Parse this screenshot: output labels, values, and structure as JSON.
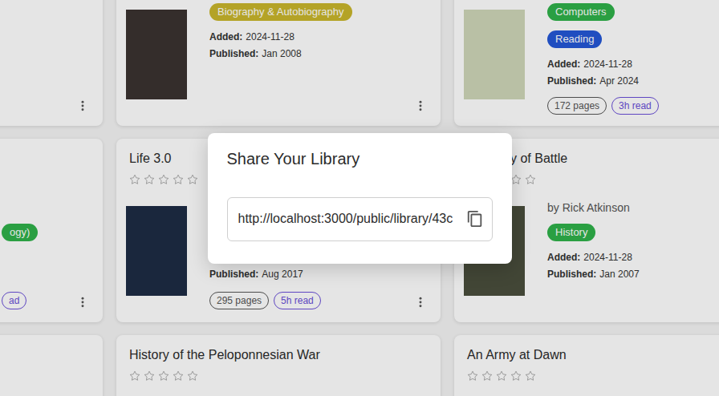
{
  "library": {
    "rows": [
      {
        "cards": [
          {
            "cover": false,
            "tags": [],
            "details": [],
            "chips": []
          },
          {
            "cover": true,
            "tags": [
              {
                "label": "Biography & Autobiography",
                "color": "#c9b62c"
              }
            ],
            "details": [
              {
                "label": "Added:",
                "value": "2024-11-28"
              },
              {
                "label": "Published:",
                "value": "Jan 2008"
              }
            ],
            "chips": []
          },
          {
            "cover": true,
            "tags": [
              {
                "label": "Computers",
                "color": "#2fb24a"
              },
              {
                "label": "Reading",
                "color": "#2457d6"
              }
            ],
            "details": [
              {
                "label": "Added:",
                "value": "2024-11-28"
              },
              {
                "label": "Published:",
                "value": "Apr 2024"
              }
            ],
            "chips": [
              {
                "label": "172 pages",
                "color": "#555555"
              },
              {
                "label": "3h read",
                "color": "#6a4fd8"
              }
            ]
          }
        ]
      },
      {
        "cards": [
          {
            "cover": false,
            "tags": [
              {
                "label": "ogy)",
                "color": "#2fb24a"
              }
            ],
            "details": [],
            "chips": [
              {
                "label": "ad",
                "color": "#6a4fd8"
              }
            ]
          },
          {
            "title": "Life 3.0",
            "stars": 0,
            "cover": true,
            "tags": [],
            "details": [
              {
                "label": "Published:",
                "value": "Aug 2017"
              }
            ],
            "chips": [
              {
                "label": "295 pages",
                "color": "#555555"
              },
              {
                "label": "5h read",
                "color": "#6a4fd8"
              }
            ]
          },
          {
            "title": "y of Battle",
            "stars": 0,
            "author": "by Rick Atkinson",
            "cover": true,
            "tags": [
              {
                "label": "History",
                "color": "#2fb24a"
              }
            ],
            "details": [
              {
                "label": "Added:",
                "value": "2024-11-28"
              },
              {
                "label": "Published:",
                "value": "Jan 2007"
              }
            ],
            "chips": []
          }
        ]
      },
      {
        "cards": [
          {
            "cover": false,
            "tags": [],
            "details": [],
            "chips": []
          },
          {
            "title": "History of the Peloponnesian War",
            "stars": 0,
            "cover": false,
            "tags": [],
            "details": [],
            "chips": []
          },
          {
            "title": "An Army at Dawn",
            "stars": 0,
            "cover": false,
            "tags": [],
            "details": [],
            "chips": []
          }
        ]
      }
    ]
  },
  "dialog": {
    "title": "Share Your Library",
    "link": "http://localhost:3000/public/library/43c"
  }
}
